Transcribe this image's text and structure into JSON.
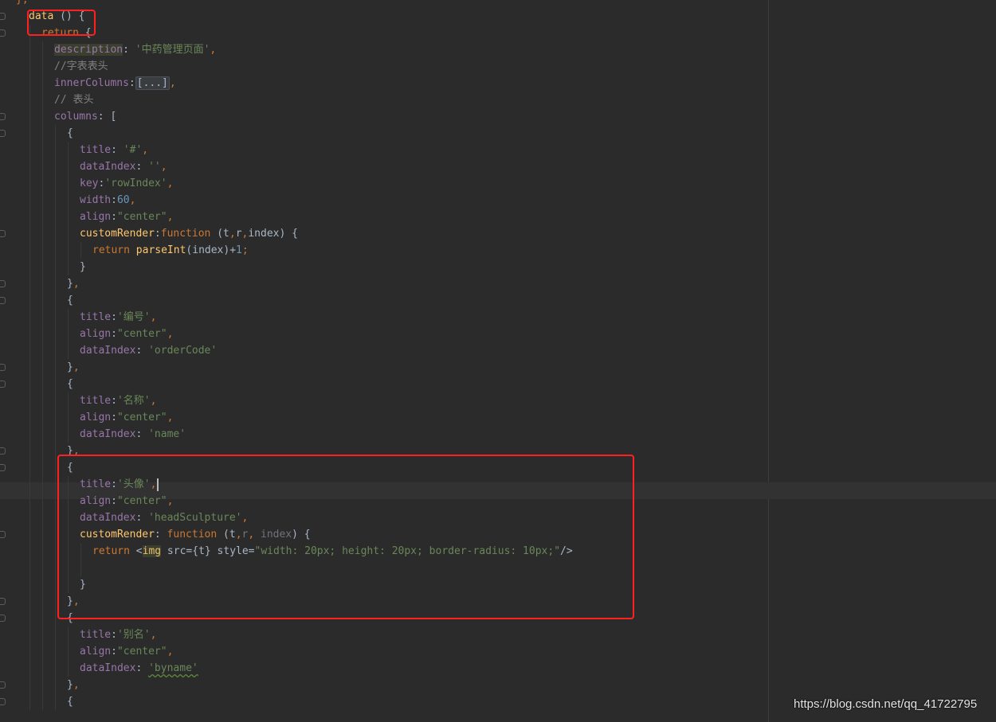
{
  "editor": {
    "lines": [
      [
        [
          "},",
          "punct"
        ]
      ],
      [
        [
          "data",
          "fn"
        ],
        [
          " () {",
          "plain"
        ]
      ],
      [
        [
          "return",
          "kw"
        ],
        [
          " {",
          "plain"
        ]
      ],
      [
        [
          "description",
          "prop hl"
        ],
        [
          ": ",
          "plain"
        ],
        [
          "'中药管理页面'",
          "str"
        ],
        [
          ",",
          "punct"
        ]
      ],
      [
        [
          "//字表表头",
          "cmt"
        ]
      ],
      [
        [
          "innerColumns",
          "prop"
        ],
        [
          ":",
          "plain"
        ],
        [
          "[...]",
          "fold"
        ],
        [
          ",",
          "punct"
        ]
      ],
      [
        [
          "// 表头",
          "cmt"
        ]
      ],
      [
        [
          "columns",
          "prop"
        ],
        [
          ": [",
          "plain"
        ]
      ],
      [
        [
          "{",
          "plain"
        ]
      ],
      [
        [
          "title",
          "prop"
        ],
        [
          ": ",
          "plain"
        ],
        [
          "'#'",
          "str"
        ],
        [
          ",",
          "punct"
        ]
      ],
      [
        [
          "dataIndex",
          "prop"
        ],
        [
          ": ",
          "plain"
        ],
        [
          "''",
          "str"
        ],
        [
          ",",
          "punct"
        ]
      ],
      [
        [
          "key",
          "prop"
        ],
        [
          ":",
          "plain"
        ],
        [
          "'rowIndex'",
          "str"
        ],
        [
          ",",
          "punct"
        ]
      ],
      [
        [
          "width",
          "prop"
        ],
        [
          ":",
          "plain"
        ],
        [
          "60",
          "num"
        ],
        [
          ",",
          "punct"
        ]
      ],
      [
        [
          "align",
          "prop"
        ],
        [
          ":",
          "plain"
        ],
        [
          "\"center\"",
          "str"
        ],
        [
          ",",
          "punct"
        ]
      ],
      [
        [
          "customRender",
          "fn"
        ],
        [
          ":",
          "plain"
        ],
        [
          "function",
          "kw"
        ],
        [
          " (t",
          "plain"
        ],
        [
          ",",
          "punct"
        ],
        [
          "r",
          "plain"
        ],
        [
          ",",
          "punct"
        ],
        [
          "index) {",
          "plain"
        ]
      ],
      [
        [
          "return",
          "kw"
        ],
        [
          " ",
          "plain"
        ],
        [
          "parseInt",
          "fn"
        ],
        [
          "(index)+",
          "plain"
        ],
        [
          "1",
          "num"
        ],
        [
          ";",
          "punct"
        ]
      ],
      [
        [
          "}",
          "plain"
        ]
      ],
      [
        [
          "}",
          "plain"
        ],
        [
          ",",
          "punct"
        ]
      ],
      [
        [
          "{",
          "plain"
        ]
      ],
      [
        [
          "title",
          "prop"
        ],
        [
          ":",
          "plain"
        ],
        [
          "'编号'",
          "str"
        ],
        [
          ",",
          "punct"
        ]
      ],
      [
        [
          "align",
          "prop"
        ],
        [
          ":",
          "plain"
        ],
        [
          "\"center\"",
          "str"
        ],
        [
          ",",
          "punct"
        ]
      ],
      [
        [
          "dataIndex",
          "prop"
        ],
        [
          ": ",
          "plain"
        ],
        [
          "'orderCode'",
          "str"
        ]
      ],
      [
        [
          "}",
          "plain"
        ],
        [
          ",",
          "punct"
        ]
      ],
      [
        [
          "{",
          "plain"
        ]
      ],
      [
        [
          "title",
          "prop"
        ],
        [
          ":",
          "plain"
        ],
        [
          "'名称'",
          "str"
        ],
        [
          ",",
          "punct"
        ]
      ],
      [
        [
          "align",
          "prop"
        ],
        [
          ":",
          "plain"
        ],
        [
          "\"center\"",
          "str"
        ],
        [
          ",",
          "punct"
        ]
      ],
      [
        [
          "dataIndex",
          "prop"
        ],
        [
          ": ",
          "plain"
        ],
        [
          "'name'",
          "str"
        ]
      ],
      [
        [
          "}",
          "plain"
        ],
        [
          ",",
          "punct"
        ]
      ],
      [
        [
          "{",
          "plain"
        ]
      ],
      [
        [
          "title",
          "prop"
        ],
        [
          ":",
          "plain"
        ],
        [
          "'头像'",
          "str"
        ],
        [
          ",",
          "punct"
        ]
      ],
      [
        [
          "align",
          "prop"
        ],
        [
          ":",
          "plain"
        ],
        [
          "\"center\"",
          "str"
        ],
        [
          ",",
          "punct"
        ]
      ],
      [
        [
          "dataIndex",
          "prop"
        ],
        [
          ": ",
          "plain"
        ],
        [
          "'headSculpture'",
          "str"
        ],
        [
          ",",
          "punct"
        ]
      ],
      [
        [
          "customRender",
          "fn"
        ],
        [
          ": ",
          "plain"
        ],
        [
          "function",
          "kw"
        ],
        [
          " (t",
          "plain"
        ],
        [
          ",",
          "punct"
        ],
        [
          "r",
          "param-unused"
        ],
        [
          ", ",
          "punct"
        ],
        [
          "index",
          "param-unused"
        ],
        [
          ") {",
          "plain"
        ]
      ],
      [
        [
          "return",
          "kw"
        ],
        [
          " <",
          "plain"
        ],
        [
          "img",
          "tag"
        ],
        [
          " src={t} style=",
          "plain"
        ],
        [
          "\"width: 20px; height: 20px; border-radius: 10px;\"",
          "str"
        ],
        [
          "/>",
          "plain"
        ]
      ],
      [],
      [
        [
          "}",
          "plain"
        ]
      ],
      [
        [
          "}",
          "plain"
        ],
        [
          ",",
          "punct"
        ]
      ],
      [
        [
          "{",
          "plain"
        ]
      ],
      [
        [
          "title",
          "prop"
        ],
        [
          ":",
          "plain"
        ],
        [
          "'别名'",
          "str"
        ],
        [
          ",",
          "punct"
        ]
      ],
      [
        [
          "align",
          "prop"
        ],
        [
          ":",
          "plain"
        ],
        [
          "\"center\"",
          "str"
        ],
        [
          ",",
          "punct"
        ]
      ],
      [
        [
          "dataIndex",
          "prop"
        ],
        [
          ": ",
          "plain"
        ],
        [
          "'byname'",
          "str typo"
        ]
      ],
      [
        [
          "}",
          "plain"
        ],
        [
          ",",
          "punct"
        ]
      ],
      [
        [
          "{",
          "plain"
        ]
      ]
    ]
  },
  "watermark": "https://blog.csdn.net/qq_41722795"
}
